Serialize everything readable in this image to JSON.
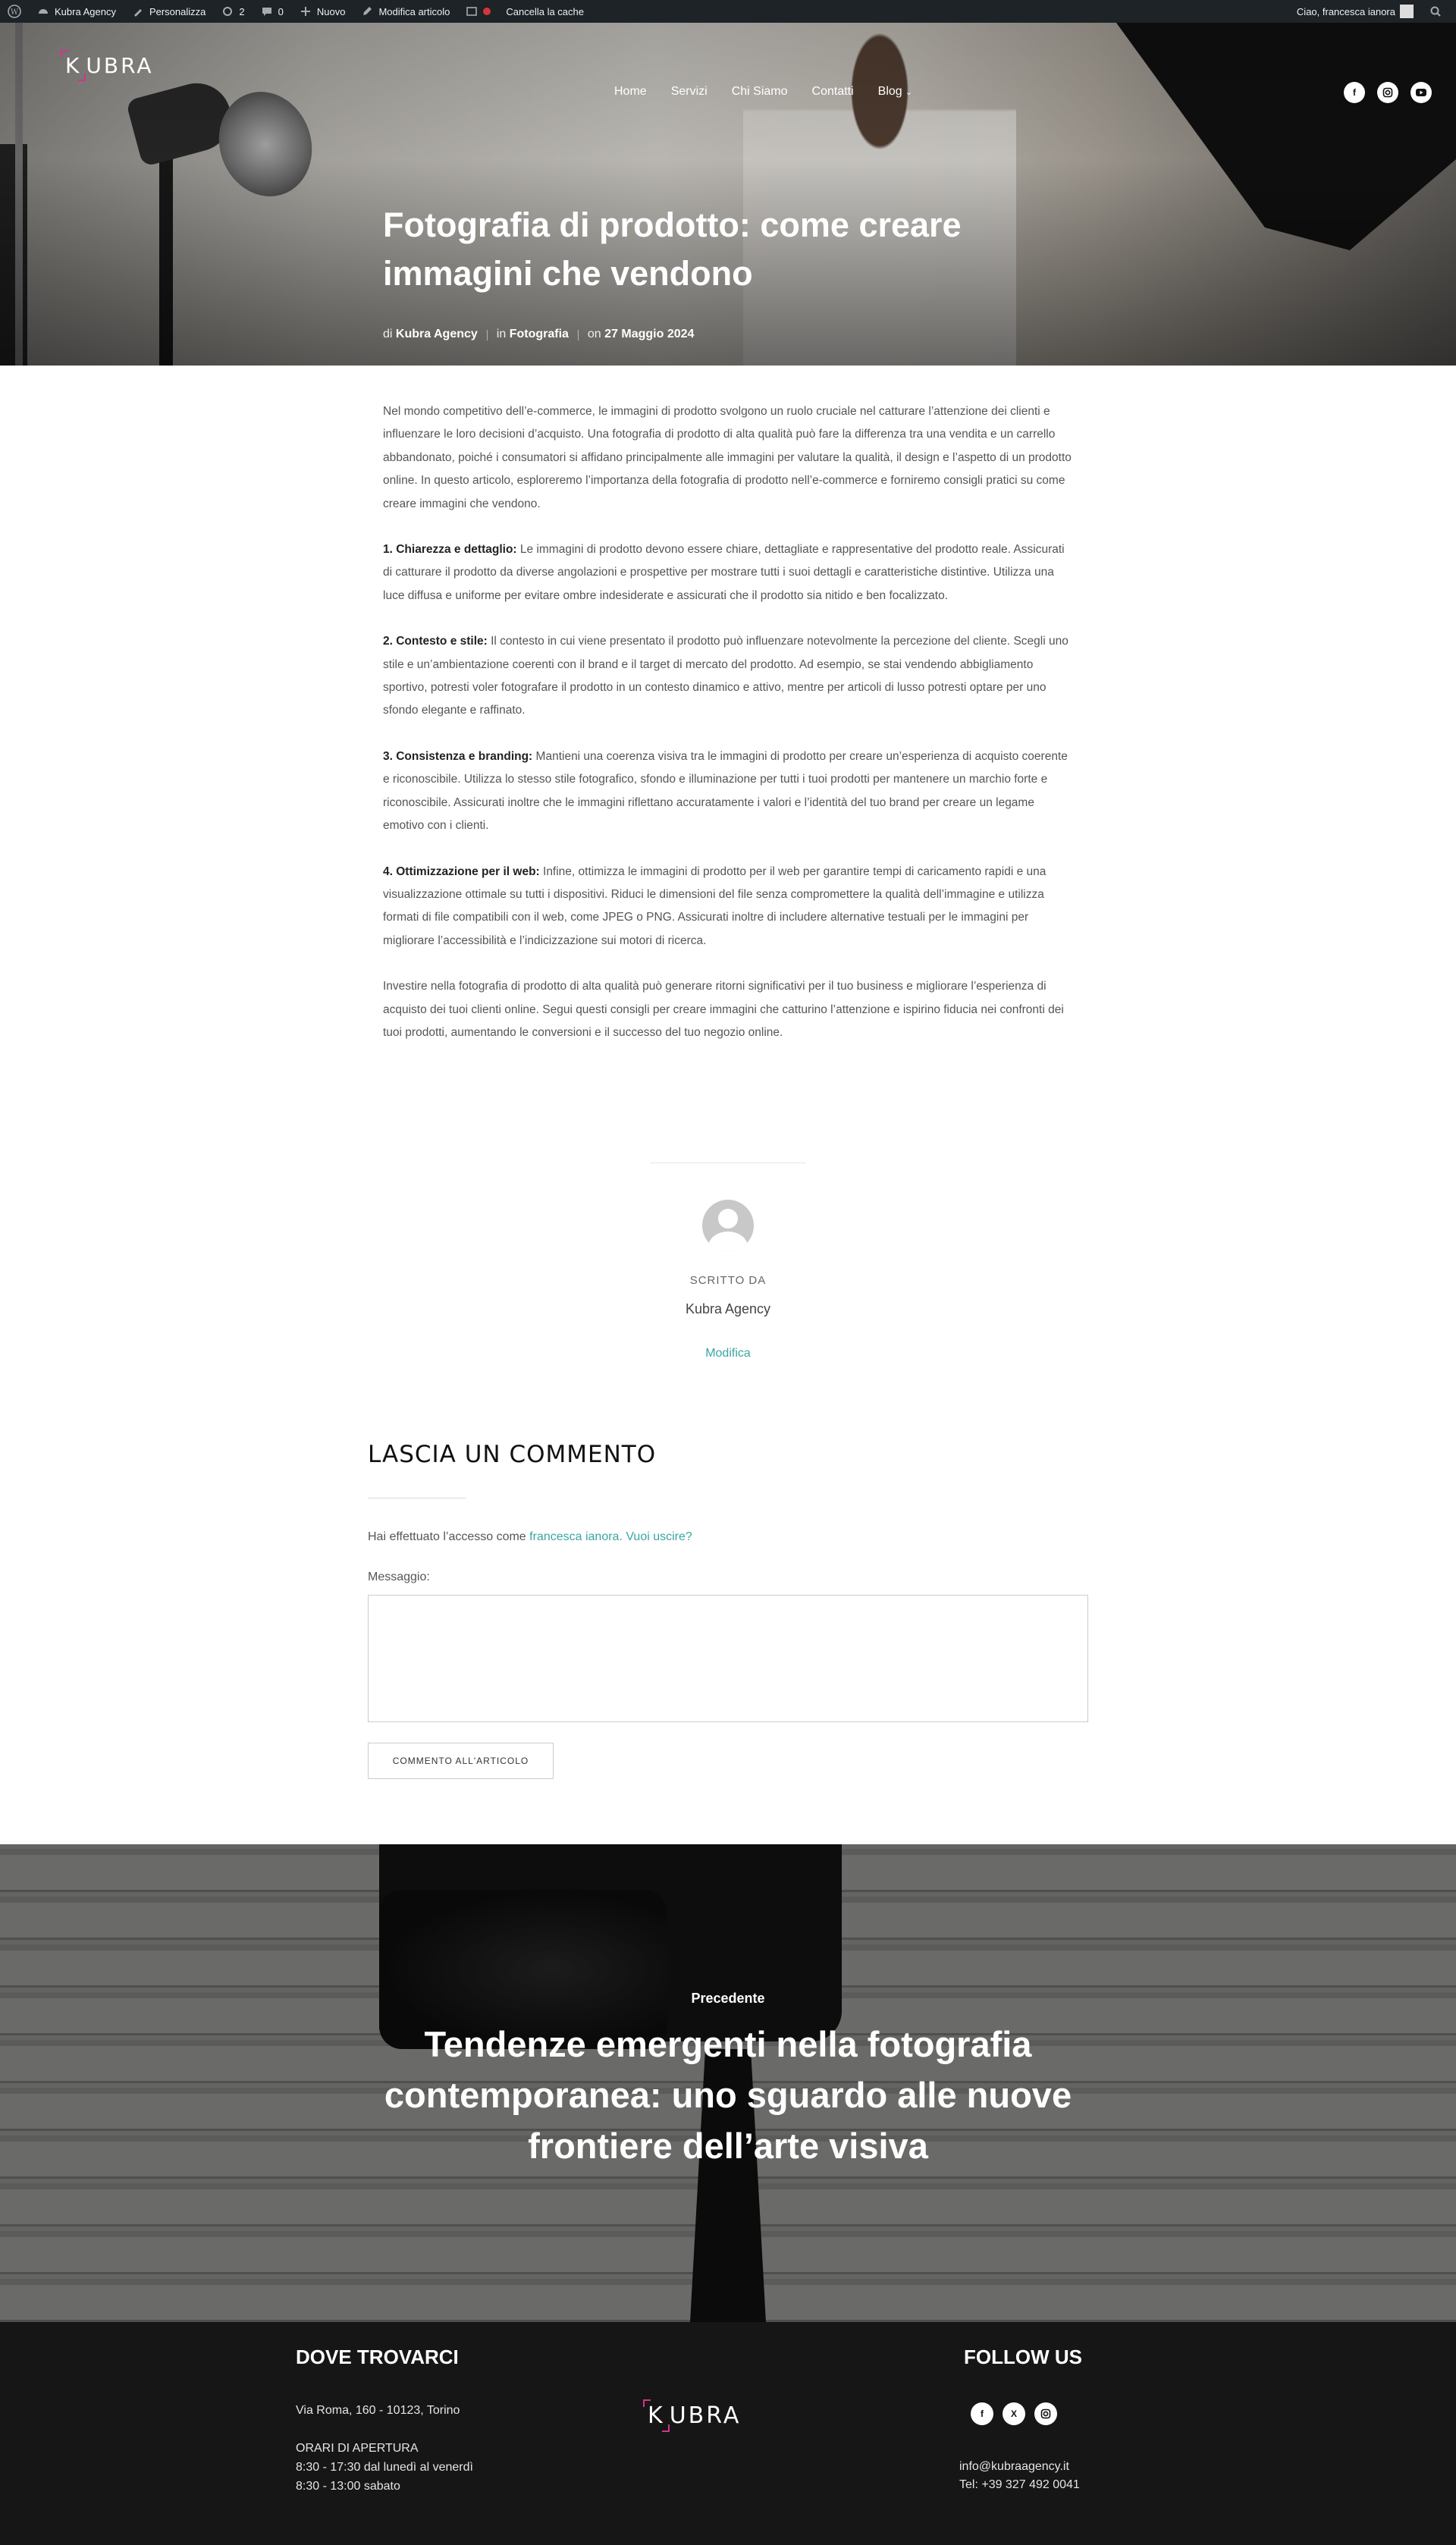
{
  "admin_bar": {
    "site_name": "Kubra Agency",
    "customize": "Personalizza",
    "updates_count": "2",
    "comments_count": "0",
    "new": "Nuovo",
    "edit_post": "Modifica articolo",
    "clear_cache": "Cancella la cache",
    "greeting": "Ciao, francesca ianora"
  },
  "header": {
    "logo_text": "UBRA",
    "logo_initial": "K",
    "nav": [
      "Home",
      "Servizi",
      "Chi Siamo",
      "Contatti",
      "Blog"
    ],
    "social_icons": [
      "facebook-icon",
      "instagram-icon",
      "youtube-icon"
    ]
  },
  "post": {
    "title": "Fotografia di prodotto: come creare immagini che vendono",
    "meta": {
      "by": "di",
      "author": "Kubra Agency",
      "in": "in",
      "category": "Fotografia",
      "on": "on",
      "date": "27 Maggio 2024"
    },
    "intro": "Nel mondo competitivo dell’e-commerce, le immagini di prodotto svolgono un ruolo cruciale nel catturare l’attenzione dei clienti e influenzare le loro decisioni d’acquisto. Una fotografia di prodotto di alta qualità può fare la differenza tra una vendita e un carrello abbandonato, poiché i consumatori si affidano principalmente alle immagini per valutare la qualità, il design e l’aspetto di un prodotto online. In questo articolo, esploreremo l’importanza della fotografia di prodotto nell’e-commerce e forniremo consigli pratici su come creare immagini che vendono.",
    "sections": [
      {
        "heading": "1. Chiarezza e dettaglio:",
        "text": " Le immagini di prodotto devono essere chiare, dettagliate e rappresentative del prodotto reale. Assicurati di catturare il prodotto da diverse angolazioni e prospettive per mostrare tutti i suoi dettagli e caratteristiche distintive. Utilizza una luce diffusa e uniforme per evitare ombre indesiderate e assicurati che il prodotto sia nitido e ben focalizzato."
      },
      {
        "heading": "2. Contesto e stile:",
        "text": " Il contesto in cui viene presentato il prodotto può influenzare notevolmente la percezione del cliente. Scegli uno stile e un’ambientazione coerenti con il brand e il target di mercato del prodotto. Ad esempio, se stai vendendo abbigliamento sportivo, potresti voler fotografare il prodotto in un contesto dinamico e attivo, mentre per articoli di lusso potresti optare per uno sfondo elegante e raffinato."
      },
      {
        "heading": "3. Consistenza e branding:",
        "text": " Mantieni una coerenza visiva tra le immagini di prodotto per creare un’esperienza di acquisto coerente e riconoscibile. Utilizza lo stesso stile fotografico, sfondo e illuminazione per tutti i tuoi prodotti per mantenere un marchio forte e riconoscibile. Assicurati inoltre che le immagini riflettano accuratamente i valori e l’identità del tuo brand per creare un legame emotivo con i clienti."
      },
      {
        "heading": "4. Ottimizzazione per il web:",
        "text": " Infine, ottimizza le immagini di prodotto per il web per garantire tempi di caricamento rapidi e una visualizzazione ottimale su tutti i dispositivi. Riduci le dimensioni del file senza compromettere la qualità dell’immagine e utilizza formati di file compatibili con il web, come JPEG o PNG. Assicurati inoltre di includere alternative testuali per le immagini per migliorare l’accessibilità e l’indicizzazione sui motori di ricerca."
      }
    ],
    "conclusion": "Investire nella fotografia di prodotto di alta qualità può generare ritorni significativi per il tuo business e migliorare l’esperienza di acquisto dei tuoi clienti online. Segui questi consigli per creare immagini che catturino l’attenzione e ispirino fiducia nei confronti dei tuoi prodotti, aumentando le conversioni e il successo del tuo negozio online."
  },
  "author_box": {
    "label": "SCRITTO DA",
    "name": "Kubra Agency",
    "edit": "Modifica"
  },
  "comments": {
    "title": "LASCIA UN COMMENTO",
    "logged_prefix": "Hai effettuato l’accesso come ",
    "logged_user": "francesca ianora",
    "logout": "Vuoi uscire?",
    "message_label": "Messaggio:",
    "message_value": "",
    "submit": "COMMENTO ALL'ARTICOLO"
  },
  "prev_post": {
    "label": "Precedente",
    "title": "Tendenze emergenti nella fotografia contemporanea: uno sguardo alle nuove frontiere dell’arte visiva"
  },
  "footer": {
    "where_title": "DOVE TROVARCI",
    "address": "Via Roma, 160 - 10123, Torino",
    "hours_title": "ORARI DI APERTURA",
    "hours_week": "8:30 - 17:30 dal lunedì al venerdì",
    "hours_sat": "8:30 - 13:00 sabato",
    "follow_title": "FOLLOW US",
    "social_icons": [
      "facebook-icon",
      "x-icon",
      "instagram-icon"
    ],
    "email": "info@kubraagency.it",
    "phone": "Tel: +39 327 492 0041"
  },
  "colors": {
    "accent": "#3aa6a0",
    "logo_brackets": "#d0368a",
    "admin_bar": "#1d2327",
    "footer_bg": "#161616"
  }
}
